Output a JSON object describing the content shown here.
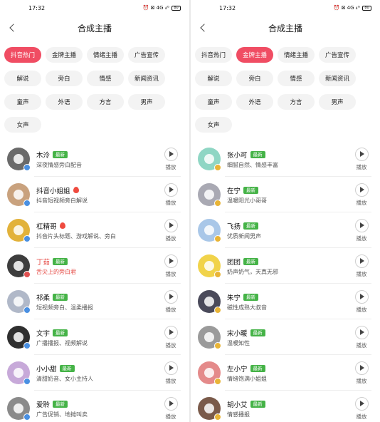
{
  "status": {
    "time": "17:32",
    "icons": "⏰ ⊠ 4G ₄ᴳ",
    "battery": "80"
  },
  "phones": [
    {
      "title": "合成主播",
      "tags": [
        {
          "label": "抖音热门",
          "active": true
        },
        {
          "label": "金牌主播",
          "active": false
        },
        {
          "label": "情绪主播",
          "active": false
        },
        {
          "label": "广告宣传",
          "active": false
        },
        {
          "label": "解说",
          "active": false
        },
        {
          "label": "旁白",
          "active": false
        },
        {
          "label": "情感",
          "active": false
        },
        {
          "label": "新闻资讯",
          "active": false
        },
        {
          "label": "童声",
          "active": false
        },
        {
          "label": "外语",
          "active": false
        },
        {
          "label": "方言",
          "active": false
        },
        {
          "label": "男声",
          "active": false
        },
        {
          "label": "女声",
          "active": false
        }
      ],
      "voices": [
        {
          "name": "木泠",
          "badge": "最新",
          "hot": false,
          "red": false,
          "desc": "深夜情感旁白配音",
          "play": "播放",
          "color": "#6a6a6a",
          "badge_color": "#4a90e2"
        },
        {
          "name": "抖音小姐姐",
          "badge": "",
          "hot": true,
          "red": false,
          "desc": "抖音短视频旁白解说",
          "play": "播放",
          "color": "#c9a27e",
          "badge_color": "#4a90e2"
        },
        {
          "name": "杠精哥",
          "badge": "",
          "hot": true,
          "red": false,
          "desc": "抖音片头标题、游戏解说、旁白",
          "play": "播放",
          "color": "#e2b23a",
          "badge_color": "#4a90e2"
        },
        {
          "name": "丁茹",
          "badge": "最新",
          "hot": false,
          "red": true,
          "desc": "舌尖上的旁白君",
          "play": "播放",
          "color": "#3d3d3d",
          "badge_color": "#e05050"
        },
        {
          "name": "祁柔",
          "badge": "最新",
          "hot": false,
          "red": false,
          "desc": "短视频旁白、温柔播报",
          "play": "播放",
          "color": "#b0b8c8",
          "badge_color": "#4a90e2"
        },
        {
          "name": "文宇",
          "badge": "最新",
          "hot": false,
          "red": false,
          "desc": "广播播报、视频解说",
          "play": "播放",
          "color": "#2f2f2f",
          "badge_color": "#4a90e2"
        },
        {
          "name": "小小甜",
          "badge": "最新",
          "hot": false,
          "red": false,
          "desc": "清甜奶音、女小主持人",
          "play": "播放",
          "color": "#c7a9d9",
          "badge_color": "#4a90e2"
        },
        {
          "name": "爱聆",
          "badge": "最新",
          "hot": false,
          "red": false,
          "desc": "广告促销、地摊叫卖",
          "play": "播放",
          "color": "#8a8a8a",
          "badge_color": "#4a90e2"
        }
      ]
    },
    {
      "title": "合成主播",
      "tags": [
        {
          "label": "抖音热门",
          "active": false
        },
        {
          "label": "金牌主播",
          "active": true
        },
        {
          "label": "情绪主播",
          "active": false
        },
        {
          "label": "广告宣传",
          "active": false
        },
        {
          "label": "解说",
          "active": false
        },
        {
          "label": "旁白",
          "active": false
        },
        {
          "label": "情感",
          "active": false
        },
        {
          "label": "新闻资讯",
          "active": false
        },
        {
          "label": "童声",
          "active": false
        },
        {
          "label": "外语",
          "active": false
        },
        {
          "label": "方言",
          "active": false
        },
        {
          "label": "男声",
          "active": false
        },
        {
          "label": "女声",
          "active": false
        }
      ],
      "voices": [
        {
          "name": "张小可",
          "badge": "最新",
          "hot": false,
          "red": false,
          "desc": "细腻自然、情感丰富",
          "play": "播放",
          "color": "#8fd6c4",
          "badge_color": "#e8b437"
        },
        {
          "name": "在宁",
          "badge": "最新",
          "hot": false,
          "red": false,
          "desc": "温暖阳光小哥哥",
          "play": "播放",
          "color": "#a9a9b3",
          "badge_color": "#e8b437"
        },
        {
          "name": "飞扬",
          "badge": "最新",
          "hot": false,
          "red": false,
          "desc": "优质新闻男声",
          "play": "播放",
          "color": "#a9c7e8",
          "badge_color": "#e8b437"
        },
        {
          "name": "团团",
          "badge": "最新",
          "hot": false,
          "red": false,
          "desc": "奶声奶气，天真无邪",
          "play": "播放",
          "color": "#f1d34a",
          "badge_color": "#e8b437"
        },
        {
          "name": "朱宁",
          "badge": "最新",
          "hot": false,
          "red": false,
          "desc": "磁性成熟大叔音",
          "play": "播放",
          "color": "#4a4a5a",
          "badge_color": "#e8b437"
        },
        {
          "name": "宋小暖",
          "badge": "最新",
          "hot": false,
          "red": false,
          "desc": "温暖知性",
          "play": "播放",
          "color": "#9a9a9a",
          "badge_color": "#e8b437"
        },
        {
          "name": "左小宁",
          "badge": "最新",
          "hot": false,
          "red": false,
          "desc": "情绪饱满小姐姐",
          "play": "播放",
          "color": "#e48a8a",
          "badge_color": "#e8b437"
        },
        {
          "name": "胡小艾",
          "badge": "最新",
          "hot": false,
          "red": false,
          "desc": "情感播报",
          "play": "播放",
          "color": "#7a5a4a",
          "badge_color": "#e8b437"
        }
      ]
    }
  ]
}
